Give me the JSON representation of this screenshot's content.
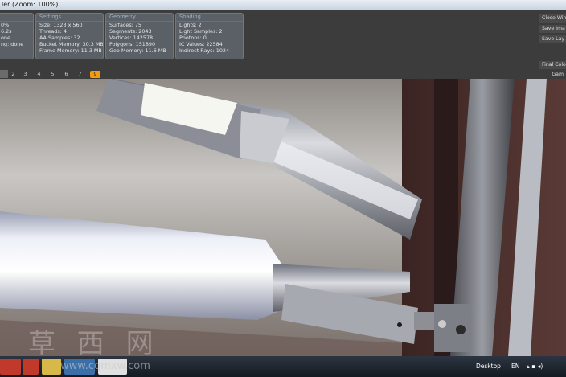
{
  "window": {
    "title": "ler (Zoom: 100%)"
  },
  "stats": {
    "partial": {
      "rows": [
        "0%",
        "6.2s",
        "one",
        "ng: done"
      ]
    },
    "settings": {
      "header": "Settings",
      "rows": [
        "Size: 1323 x 560",
        "Threads: 4",
        "AA Samples: 32",
        "Bucket Memory: 30.3 MB",
        "Frame Memory: 11.3 MB"
      ]
    },
    "geometry": {
      "header": "Geometry",
      "rows": [
        "Surfaces: 75",
        "Segments: 2043",
        "Vertices: 142578",
        "Polygons: 151890",
        "Geo Memory: 11.6 MB"
      ]
    },
    "shading": {
      "header": "Shading",
      "rows": [
        "Lights: 2",
        "Light Samples: 2",
        "Photons: 0",
        "IC Values: 22584",
        "Indirect Rays: 1024"
      ]
    }
  },
  "right_buttons": {
    "close": "Close Win",
    "save_image": "Save Ima",
    "save_layers": "Save Lay",
    "final_color": "Final Colo",
    "gamma": "Gam"
  },
  "passes": [
    "2",
    "3",
    "4",
    "5",
    "6",
    "7",
    "8",
    "9"
  ],
  "active_pass": "9",
  "taskbar": {
    "desktop": "Desktop",
    "lang": "EN",
    "watermark_cn": "草 西 网",
    "watermark_url": "www.cgmxw.com"
  },
  "colors": {
    "accent": "#f39c12",
    "panel": "#3c3c3c",
    "box": "#5b6066",
    "taskbar": "#1b222b"
  }
}
